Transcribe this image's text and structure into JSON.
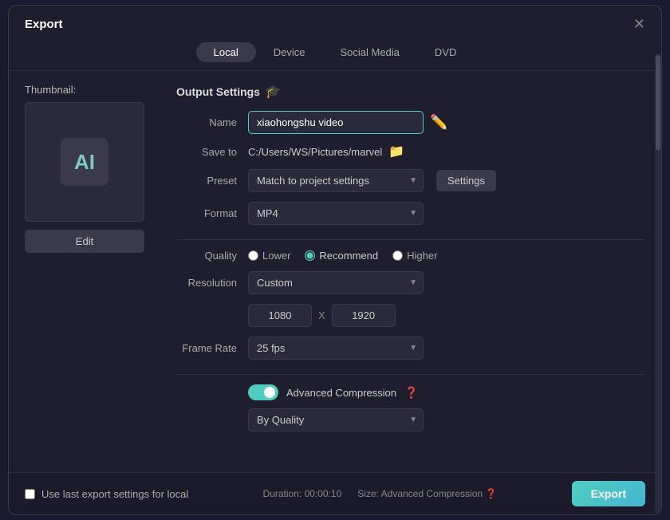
{
  "dialog": {
    "title": "Export",
    "close_label": "✕"
  },
  "tabs": [
    {
      "label": "Local",
      "active": true
    },
    {
      "label": "Device",
      "active": false
    },
    {
      "label": "Social Media",
      "active": false
    },
    {
      "label": "DVD",
      "active": false
    }
  ],
  "left": {
    "thumbnail_label": "Thumbnail:",
    "edit_label": "Edit"
  },
  "output_settings": {
    "title": "Output Settings",
    "name_label": "Name",
    "name_value": "xiaohongshu video",
    "save_to_label": "Save to",
    "save_to_path": "C:/Users/WS/Pictures/marvel",
    "preset_label": "Preset",
    "preset_value": "Match to project settings",
    "settings_label": "Settings",
    "format_label": "Format",
    "format_value": "MP4",
    "quality_label": "Quality",
    "quality_options": [
      {
        "label": "Lower",
        "value": "lower"
      },
      {
        "label": "Recommend",
        "value": "recommend",
        "checked": true
      },
      {
        "label": "Higher",
        "value": "higher"
      }
    ],
    "resolution_label": "Resolution",
    "resolution_value": "Custom",
    "width": "1080",
    "height": "1920",
    "frame_rate_label": "Frame Rate",
    "frame_rate_value": "25 fps",
    "advanced_compression_label": "Advanced Compression",
    "advanced_compression_enabled": true,
    "by_quality_value": "By Quality"
  },
  "footer": {
    "checkbox_label": "Use last export settings for local",
    "duration_label": "Duration: 00:00:10",
    "size_label": "Size: Advanced Compression",
    "export_label": "Export"
  }
}
